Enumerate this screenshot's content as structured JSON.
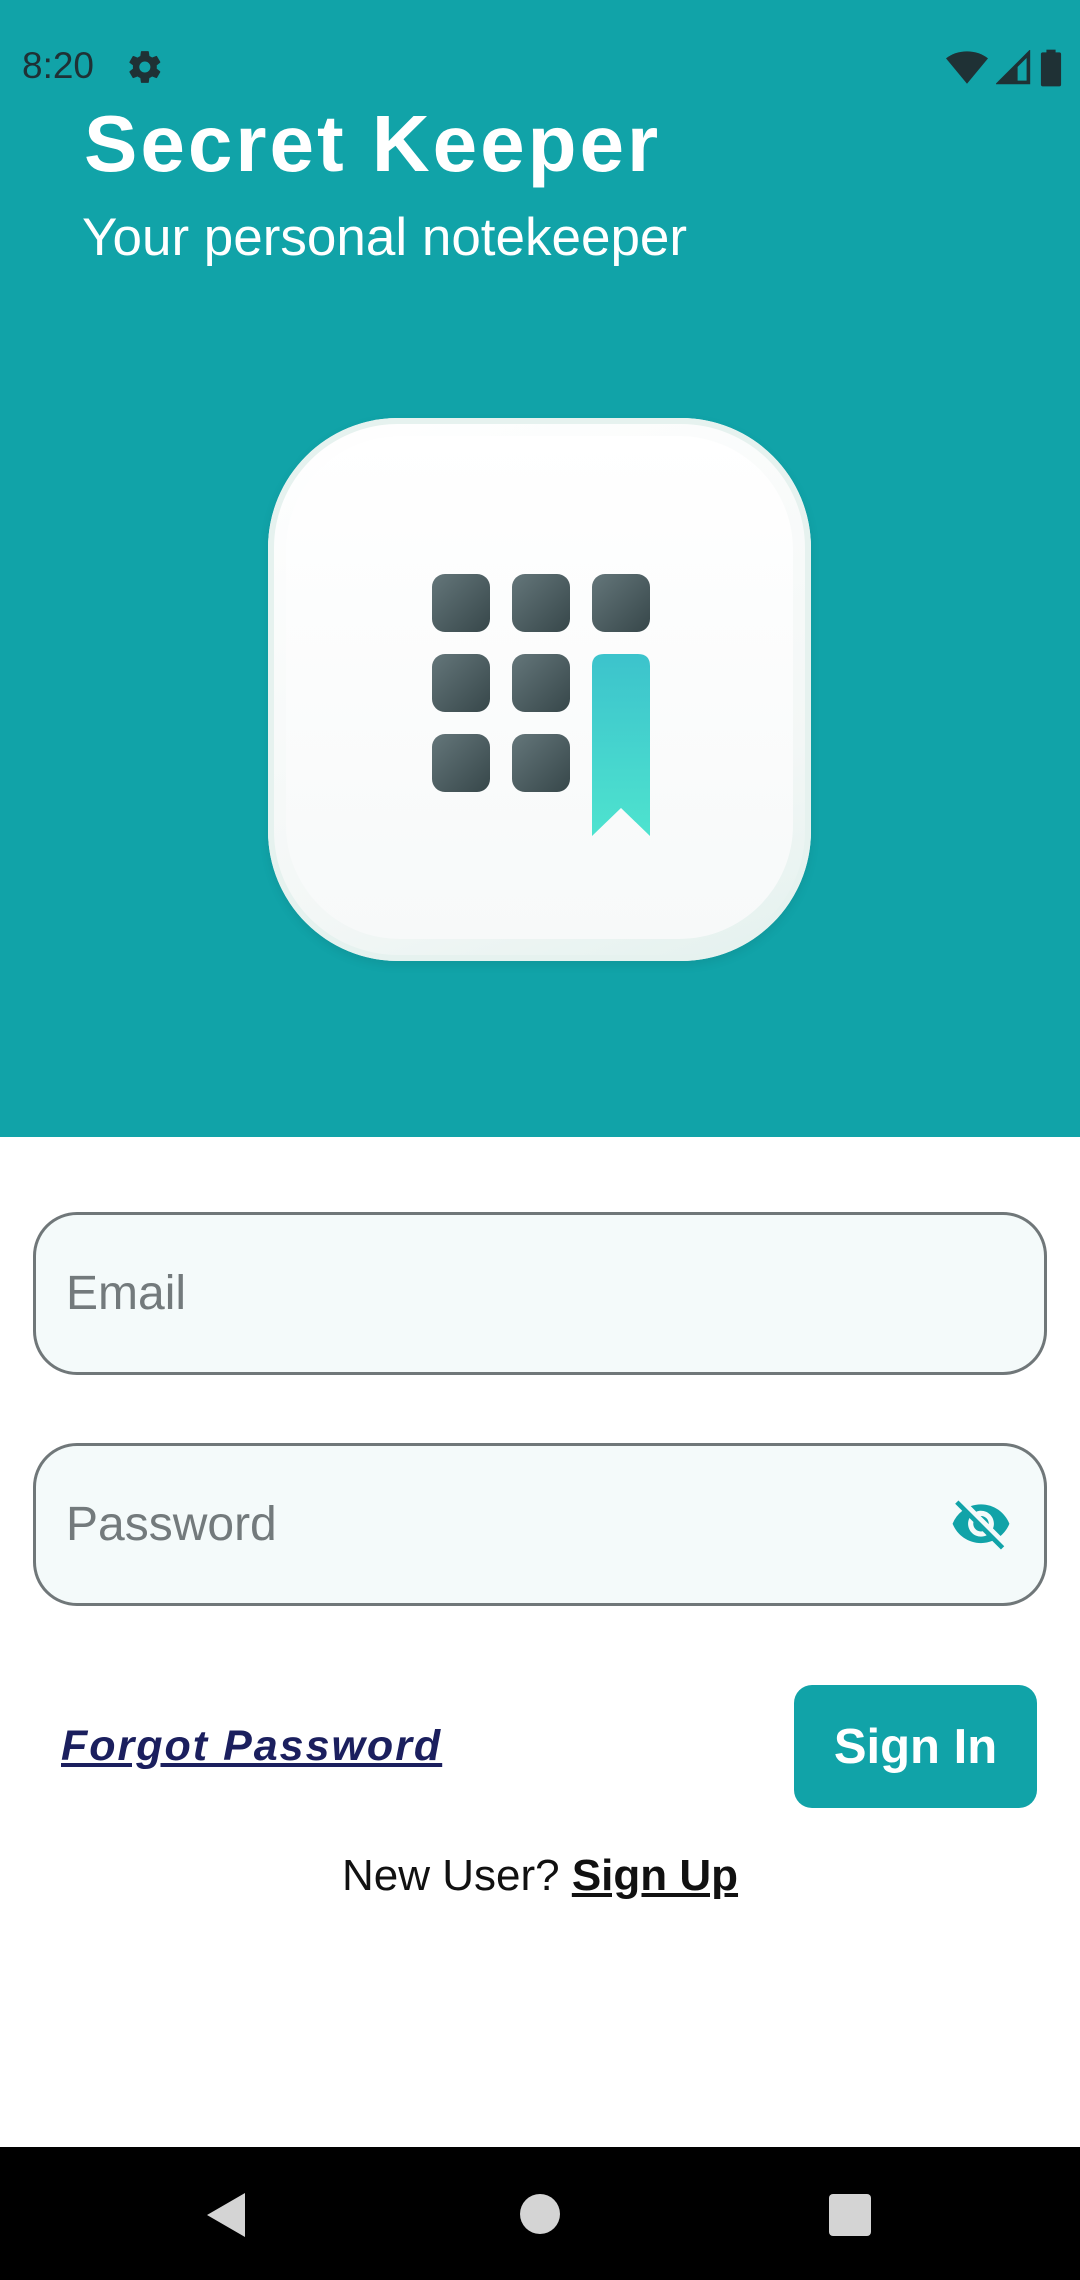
{
  "status_bar": {
    "time": "8:20",
    "left_icons": [
      "gear-icon"
    ],
    "right_icons": [
      "wifi-icon",
      "signal-icon",
      "battery-icon"
    ]
  },
  "header": {
    "title": "Secret Keeper",
    "subtitle": "Your personal notekeeper",
    "background_color": "#11a3a8",
    "logo_icon": "notekeeper-app-icon"
  },
  "form": {
    "email": {
      "placeholder": "Email",
      "value": ""
    },
    "password": {
      "placeholder": "Password",
      "value": "",
      "toggle_icon": "eye-off-icon"
    },
    "forgot_password_label": "Forgot Password",
    "sign_in_label": "Sign In",
    "new_user_prompt": "New User?",
    "sign_up_label": "Sign Up",
    "accent_color": "#11a3a8",
    "link_color": "#1b1f5e"
  },
  "nav_bar": {
    "buttons": [
      "back-icon",
      "home-icon",
      "recents-icon"
    ]
  }
}
